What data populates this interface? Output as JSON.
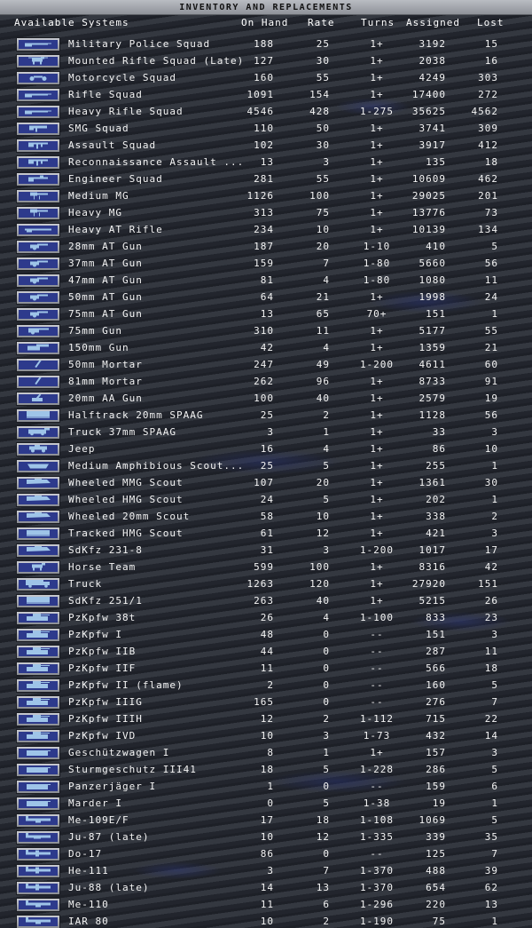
{
  "title": "INVENTORY AND REPLACEMENTS",
  "headers": {
    "name": "Available Systems",
    "on_hand": "On Hand",
    "rate": "Rate",
    "turns": "Turns",
    "assigned": "Assigned",
    "lost": "Lost"
  },
  "colors": {
    "icon_background": "#2d3a8c",
    "icon_frame": "#b0b3b9",
    "icon_glyph": "#9ec4e8",
    "text": "#f4f4f4",
    "title_bar": "#a6a9b0"
  },
  "rows": [
    {
      "icon": "rifle-icon",
      "name": "Military Police Squad",
      "on_hand": "188",
      "rate": "25",
      "turns": "1+",
      "assigned": "3192",
      "lost": "15"
    },
    {
      "icon": "horse-rifle-icon",
      "name": "Mounted Rifle Squad (Late)",
      "on_hand": "127",
      "rate": "30",
      "turns": "1+",
      "assigned": "2038",
      "lost": "16"
    },
    {
      "icon": "motorcycle-icon",
      "name": "Motorcycle Squad",
      "on_hand": "160",
      "rate": "55",
      "turns": "1+",
      "assigned": "4249",
      "lost": "303"
    },
    {
      "icon": "rifle-icon",
      "name": "Rifle Squad",
      "on_hand": "1091",
      "rate": "154",
      "turns": "1+",
      "assigned": "17400",
      "lost": "272"
    },
    {
      "icon": "rifle-icon",
      "name": "Heavy Rifle Squad",
      "on_hand": "4546",
      "rate": "428",
      "turns": "1-275",
      "assigned": "35625",
      "lost": "4562"
    },
    {
      "icon": "smg-icon",
      "name": "SMG Squad",
      "on_hand": "110",
      "rate": "50",
      "turns": "1+",
      "assigned": "3741",
      "lost": "309"
    },
    {
      "icon": "assault-rifle-icon",
      "name": "Assault Squad",
      "on_hand": "102",
      "rate": "30",
      "turns": "1+",
      "assigned": "3917",
      "lost": "412"
    },
    {
      "icon": "assault-rifle-icon",
      "name": "Reconnaissance Assault ...",
      "on_hand": "13",
      "rate": "3",
      "turns": "1+",
      "assigned": "135",
      "lost": "18"
    },
    {
      "icon": "engineer-rifle-icon",
      "name": "Engineer Squad",
      "on_hand": "281",
      "rate": "55",
      "turns": "1+",
      "assigned": "10609",
      "lost": "462"
    },
    {
      "icon": "machine-gun-icon",
      "name": "Medium MG",
      "on_hand": "1126",
      "rate": "100",
      "turns": "1+",
      "assigned": "29025",
      "lost": "201"
    },
    {
      "icon": "machine-gun-icon",
      "name": "Heavy MG",
      "on_hand": "313",
      "rate": "75",
      "turns": "1+",
      "assigned": "13776",
      "lost": "73"
    },
    {
      "icon": "anti-tank-rifle-icon",
      "name": "Heavy AT Rifle",
      "on_hand": "234",
      "rate": "10",
      "turns": "1+",
      "assigned": "10139",
      "lost": "134"
    },
    {
      "icon": "at-gun-icon",
      "name": "28mm AT Gun",
      "on_hand": "187",
      "rate": "20",
      "turns": "1-10",
      "assigned": "410",
      "lost": "5"
    },
    {
      "icon": "at-gun-icon",
      "name": "37mm AT Gun",
      "on_hand": "159",
      "rate": "7",
      "turns": "1-80",
      "assigned": "5660",
      "lost": "56"
    },
    {
      "icon": "at-gun-icon",
      "name": "47mm AT Gun",
      "on_hand": "81",
      "rate": "4",
      "turns": "1-80",
      "assigned": "1080",
      "lost": "11"
    },
    {
      "icon": "at-gun-icon",
      "name": "50mm AT Gun",
      "on_hand": "64",
      "rate": "21",
      "turns": "1+",
      "assigned": "1998",
      "lost": "24"
    },
    {
      "icon": "at-gun-icon",
      "name": "75mm AT Gun",
      "on_hand": "13",
      "rate": "65",
      "turns": "70+",
      "assigned": "151",
      "lost": "1"
    },
    {
      "icon": "field-gun-icon",
      "name": "75mm Gun",
      "on_hand": "310",
      "rate": "11",
      "turns": "1+",
      "assigned": "5177",
      "lost": "55"
    },
    {
      "icon": "howitzer-icon",
      "name": "150mm Gun",
      "on_hand": "42",
      "rate": "4",
      "turns": "1+",
      "assigned": "1359",
      "lost": "21"
    },
    {
      "icon": "mortar-icon",
      "name": "50mm Mortar",
      "on_hand": "247",
      "rate": "49",
      "turns": "1-200",
      "assigned": "4611",
      "lost": "60"
    },
    {
      "icon": "mortar-icon",
      "name": "81mm Mortar",
      "on_hand": "262",
      "rate": "96",
      "turns": "1+",
      "assigned": "8733",
      "lost": "91"
    },
    {
      "icon": "aa-gun-icon",
      "name": "20mm AA Gun",
      "on_hand": "100",
      "rate": "40",
      "turns": "1+",
      "assigned": "2579",
      "lost": "19"
    },
    {
      "icon": "halftrack-icon",
      "name": "Halftrack 20mm SPAAG",
      "on_hand": "25",
      "rate": "2",
      "turns": "1+",
      "assigned": "1128",
      "lost": "56"
    },
    {
      "icon": "truck-gun-icon",
      "name": "Truck 37mm SPAAG",
      "on_hand": "3",
      "rate": "1",
      "turns": "1+",
      "assigned": "33",
      "lost": "3"
    },
    {
      "icon": "jeep-icon",
      "name": "Jeep",
      "on_hand": "16",
      "rate": "4",
      "turns": "1+",
      "assigned": "86",
      "lost": "10"
    },
    {
      "icon": "amphibious-car-icon",
      "name": "Medium Amphibious Scout...",
      "on_hand": "25",
      "rate": "5",
      "turns": "1+",
      "assigned": "255",
      "lost": "1"
    },
    {
      "icon": "armored-car-icon",
      "name": "Wheeled MMG Scout",
      "on_hand": "107",
      "rate": "20",
      "turns": "1+",
      "assigned": "1361",
      "lost": "30"
    },
    {
      "icon": "armored-car-icon",
      "name": "Wheeled HMG Scout",
      "on_hand": "24",
      "rate": "5",
      "turns": "1+",
      "assigned": "202",
      "lost": "1"
    },
    {
      "icon": "armored-car-icon",
      "name": "Wheeled 20mm Scout",
      "on_hand": "58",
      "rate": "10",
      "turns": "1+",
      "assigned": "338",
      "lost": "2"
    },
    {
      "icon": "tracked-scout-icon",
      "name": "Tracked HMG Scout",
      "on_hand": "61",
      "rate": "12",
      "turns": "1+",
      "assigned": "421",
      "lost": "3"
    },
    {
      "icon": "armored-car-icon",
      "name": "SdKfz 231-8",
      "on_hand": "31",
      "rate": "3",
      "turns": "1-200",
      "assigned": "1017",
      "lost": "17"
    },
    {
      "icon": "horse-icon",
      "name": "Horse Team",
      "on_hand": "599",
      "rate": "100",
      "turns": "1+",
      "assigned": "8316",
      "lost": "42"
    },
    {
      "icon": "truck-icon",
      "name": "Truck",
      "on_hand": "1263",
      "rate": "120",
      "turns": "1+",
      "assigned": "27920",
      "lost": "151"
    },
    {
      "icon": "halftrack-icon",
      "name": "SdKfz 251/1",
      "on_hand": "263",
      "rate": "40",
      "turns": "1+",
      "assigned": "5215",
      "lost": "26"
    },
    {
      "icon": "tank-icon",
      "name": "PzKpfw 38t",
      "on_hand": "26",
      "rate": "4",
      "turns": "1-100",
      "assigned": "833",
      "lost": "23"
    },
    {
      "icon": "tank-icon",
      "name": "PzKpfw I",
      "on_hand": "48",
      "rate": "0",
      "turns": "--",
      "assigned": "151",
      "lost": "3"
    },
    {
      "icon": "tank-icon",
      "name": "PzKpfw IIB",
      "on_hand": "44",
      "rate": "0",
      "turns": "--",
      "assigned": "287",
      "lost": "11"
    },
    {
      "icon": "tank-icon",
      "name": "PzKpfw IIF",
      "on_hand": "11",
      "rate": "0",
      "turns": "--",
      "assigned": "566",
      "lost": "18"
    },
    {
      "icon": "tank-icon",
      "name": "PzKpfw II (flame)",
      "on_hand": "2",
      "rate": "0",
      "turns": "--",
      "assigned": "160",
      "lost": "5"
    },
    {
      "icon": "tank-icon",
      "name": "PzKpfw IIIG",
      "on_hand": "165",
      "rate": "0",
      "turns": "--",
      "assigned": "276",
      "lost": "7"
    },
    {
      "icon": "tank-icon",
      "name": "PzKpfw IIIH",
      "on_hand": "12",
      "rate": "2",
      "turns": "1-112",
      "assigned": "715",
      "lost": "22"
    },
    {
      "icon": "tank-icon",
      "name": "PzKpfw IVD",
      "on_hand": "10",
      "rate": "3",
      "turns": "1-73",
      "assigned": "432",
      "lost": "14"
    },
    {
      "icon": "assault-gun-icon",
      "name": "Geschützwagen I",
      "on_hand": "8",
      "rate": "1",
      "turns": "1+",
      "assigned": "157",
      "lost": "3"
    },
    {
      "icon": "assault-gun-icon",
      "name": "Sturmgeschutz III41",
      "on_hand": "18",
      "rate": "5",
      "turns": "1-228",
      "assigned": "286",
      "lost": "5"
    },
    {
      "icon": "assault-gun-icon",
      "name": "Panzerjäger I",
      "on_hand": "1",
      "rate": "0",
      "turns": "--",
      "assigned": "159",
      "lost": "6"
    },
    {
      "icon": "assault-gun-icon",
      "name": "Marder I",
      "on_hand": "0",
      "rate": "5",
      "turns": "1-38",
      "assigned": "19",
      "lost": "1"
    },
    {
      "icon": "fighter-plane-icon",
      "name": "Me-109E/F",
      "on_hand": "17",
      "rate": "18",
      "turns": "1-108",
      "assigned": "1069",
      "lost": "5"
    },
    {
      "icon": "dive-bomber-icon",
      "name": "Ju-87 (late)",
      "on_hand": "10",
      "rate": "12",
      "turns": "1-335",
      "assigned": "339",
      "lost": "35"
    },
    {
      "icon": "bomber-plane-icon",
      "name": "Do-17",
      "on_hand": "86",
      "rate": "0",
      "turns": "--",
      "assigned": "125",
      "lost": "7"
    },
    {
      "icon": "bomber-plane-icon",
      "name": "He-111",
      "on_hand": "3",
      "rate": "7",
      "turns": "1-370",
      "assigned": "488",
      "lost": "39"
    },
    {
      "icon": "bomber-plane-icon",
      "name": "Ju-88 (late)",
      "on_hand": "14",
      "rate": "13",
      "turns": "1-370",
      "assigned": "654",
      "lost": "62"
    },
    {
      "icon": "fighter-plane-icon",
      "name": "Me-110",
      "on_hand": "11",
      "rate": "6",
      "turns": "1-296",
      "assigned": "220",
      "lost": "13"
    },
    {
      "icon": "fighter-plane-icon",
      "name": "IAR 80",
      "on_hand": "10",
      "rate": "2",
      "turns": "1-190",
      "assigned": "75",
      "lost": "1"
    }
  ]
}
